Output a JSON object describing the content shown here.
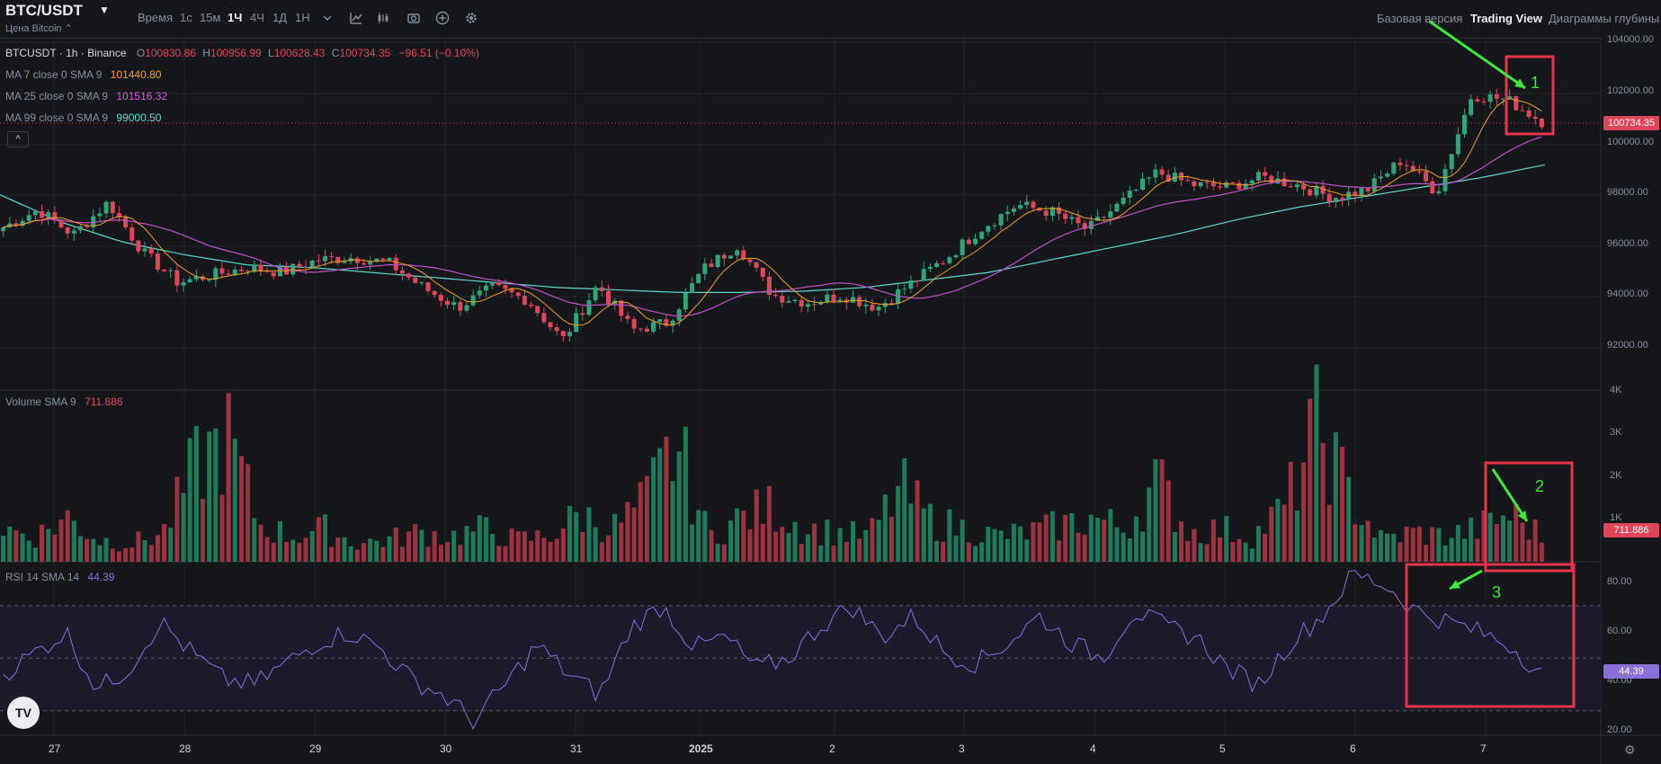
{
  "header": {
    "pair": "BTC/USDT",
    "subtitle": "Цена Bitcoin ⌃",
    "intervals": [
      "Время",
      "1с",
      "15м",
      "1Ч",
      "4Ч",
      "1Д",
      "1Н"
    ],
    "active_interval": "1Ч",
    "views": [
      "Базовая версия",
      "Trading View",
      "Диаграммы глубины"
    ],
    "active_view": "Trading View"
  },
  "legend": {
    "symbol": "BTCUSDT · 1h · Binance",
    "ohlc": [
      {
        "label": "O",
        "value": "100830.86"
      },
      {
        "label": "H",
        "value": "100956.99"
      },
      {
        "label": "L",
        "value": "100628.43"
      },
      {
        "label": "C",
        "value": "100734.35"
      }
    ],
    "change": "−96.51 (−0.10%)",
    "ma": [
      {
        "label": "MA 7 close 0 SMA 9",
        "value": "101440.80",
        "color": "#f0a020"
      },
      {
        "label": "MA 25 close 0 SMA 9",
        "value": "101516.32",
        "color": "#c050c8"
      },
      {
        "label": "MA 99 close 0 SMA 9",
        "value": "99000.50",
        "color": "#5fd8d0"
      }
    ],
    "volume": {
      "label": "Volume SMA 9",
      "value": "711.886"
    },
    "rsi": {
      "label": "RSI 14 SMA 14",
      "value": "44.39"
    }
  },
  "axes": {
    "price_ticks": [
      "104000.00",
      "102000.00",
      "100000.00",
      "98000.00",
      "96000.00",
      "94000.00",
      "92000.00"
    ],
    "volume_ticks": [
      "4K",
      "3K",
      "2K",
      "1K"
    ],
    "rsi_ticks": [
      "80.00",
      "60.00",
      "40.00",
      "20.00"
    ],
    "x_ticks": [
      "27",
      "28",
      "29",
      "30",
      "31",
      "2025",
      "2",
      "3",
      "4",
      "5",
      "6",
      "7"
    ]
  },
  "tags": {
    "price": "100734.35",
    "volume": "711.886",
    "rsi": "44.39"
  },
  "annotations": [
    "1",
    "2",
    "3"
  ],
  "colors": {
    "up": "#2ea57a",
    "down": "#e0455a",
    "ma7": "#f0a020",
    "ma25": "#c050c8",
    "ma99": "#5fd8d0",
    "rsi": "#8a6fd8",
    "annotation_box": "#e8334a",
    "annotation_arrow": "#3ee83e"
  },
  "chart_data": {
    "type": "candlestick",
    "x_range": [
      "Dec 26",
      "Jan 7"
    ],
    "price_ylim": [
      90000,
      104000
    ],
    "volume_ylim": [
      0,
      4000
    ],
    "rsi_ylim": [
      20,
      85
    ],
    "price_path": [
      96500,
      97200,
      96200,
      97500,
      95500,
      94300,
      94600,
      94900,
      94700,
      95200,
      95300,
      95100,
      94100,
      93300,
      94100,
      93600,
      92000,
      94200,
      92400,
      92700,
      94800,
      95800,
      93800,
      93500,
      93800,
      93300,
      94300,
      95300,
      96500,
      97400,
      97100,
      96400,
      97500,
      98700,
      98200,
      98100,
      98500,
      98200,
      97700,
      98000,
      99200,
      97900,
      101800,
      101600,
      100734
    ],
    "ma99_path": [
      97800,
      96700,
      95900,
      95400,
      95000,
      94900,
      94700,
      94500,
      94300,
      94100,
      94000,
      93900,
      93900,
      93950,
      94100,
      94400,
      94700,
      95200,
      95700,
      96200,
      96800,
      97300,
      97700,
      98100,
      98500,
      99000
    ],
    "volume_values": [
      900,
      700,
      1200,
      600,
      500,
      800,
      2600,
      3400,
      1000,
      700,
      900,
      500,
      600,
      800,
      700,
      900,
      600,
      700,
      1300,
      900,
      1600,
      3200,
      700,
      1200,
      1500,
      900,
      800,
      700,
      2000,
      1100,
      900,
      700,
      800,
      1000,
      1200,
      900,
      2200,
      800,
      900,
      700,
      1500,
      3700,
      1800,
      600,
      800,
      700,
      900,
      1300,
      711
    ],
    "rsi_values": [
      44,
      52,
      60,
      38,
      46,
      64,
      52,
      42,
      40,
      48,
      56,
      60,
      54,
      42,
      36,
      26,
      40,
      55,
      44,
      36,
      62,
      70,
      54,
      58,
      46,
      50,
      62,
      70,
      58,
      66,
      52,
      48,
      56,
      66,
      56,
      50,
      68,
      62,
      58,
      46,
      40,
      56,
      66,
      82,
      78,
      68,
      64,
      60,
      55,
      44
    ]
  }
}
